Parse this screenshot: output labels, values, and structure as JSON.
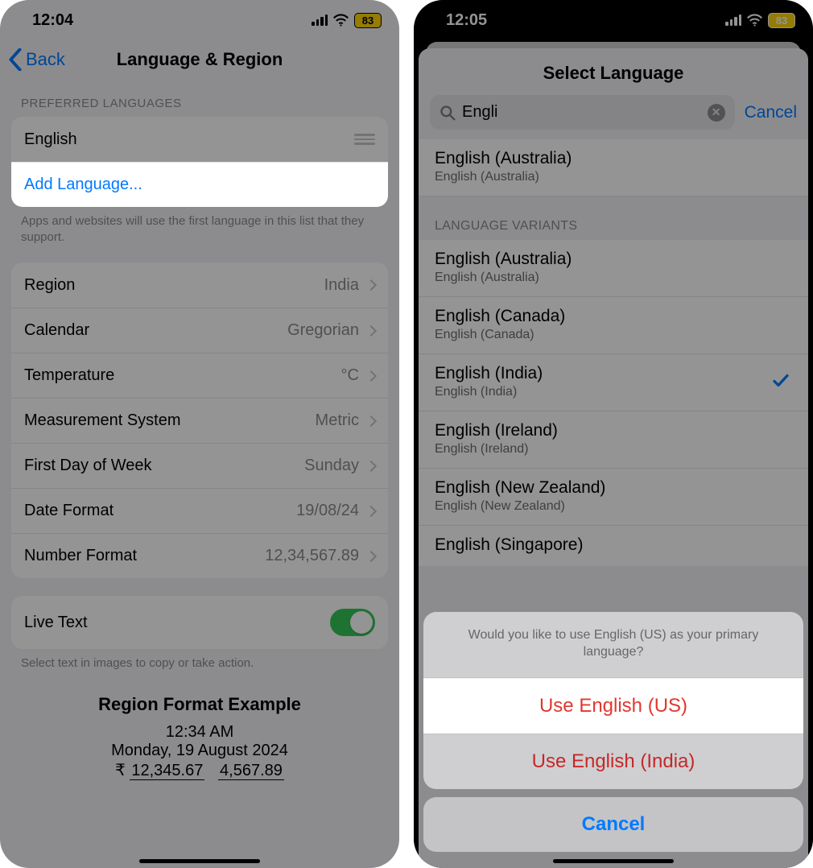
{
  "left": {
    "status": {
      "time": "12:04",
      "battery": "83"
    },
    "nav": {
      "back": "Back",
      "title": "Language & Region"
    },
    "preferred": {
      "header": "PREFERRED LANGUAGES",
      "current": "English",
      "add": "Add Language...",
      "footer": "Apps and websites will use the first language in this list that they support."
    },
    "settings": {
      "region": {
        "label": "Region",
        "value": "India"
      },
      "calendar": {
        "label": "Calendar",
        "value": "Gregorian"
      },
      "temperature": {
        "label": "Temperature",
        "value": "°C"
      },
      "measurement": {
        "label": "Measurement System",
        "value": "Metric"
      },
      "firstday": {
        "label": "First Day of Week",
        "value": "Sunday"
      },
      "dateformat": {
        "label": "Date Format",
        "value": "19/08/24"
      },
      "numberformat": {
        "label": "Number Format",
        "value": "12,34,567.89"
      }
    },
    "livetext": {
      "label": "Live Text",
      "on": true,
      "footer": "Select text in images to copy or take action."
    },
    "example": {
      "header": "Region Format Example",
      "time": "12:34 AM",
      "date": "Monday, 19 August 2024",
      "currency": "₹ 12,345.67",
      "number": "4,567.89"
    }
  },
  "right": {
    "status": {
      "time": "12:05",
      "battery": "83"
    },
    "sheet": {
      "title": "Select Language",
      "search": {
        "query": "Engli",
        "cancel": "Cancel"
      },
      "topitem": {
        "title": "English (Australia)",
        "sub": "English (Australia)"
      },
      "variants_header": "LANGUAGE VARIANTS",
      "variants": [
        {
          "title": "English (Australia)",
          "sub": "English (Australia)",
          "selected": false
        },
        {
          "title": "English (Canada)",
          "sub": "English (Canada)",
          "selected": false
        },
        {
          "title": "English (India)",
          "sub": "English (India)",
          "selected": true
        },
        {
          "title": "English (Ireland)",
          "sub": "English (Ireland)",
          "selected": false
        },
        {
          "title": "English (New Zealand)",
          "sub": "English (New Zealand)",
          "selected": false
        },
        {
          "title": "English (Singapore)",
          "sub": "",
          "selected": false
        }
      ]
    },
    "actionsheet": {
      "message": "Would you like to use English (US) as your primary language?",
      "primary": "Use English (US)",
      "secondary": "Use English (India)",
      "cancel": "Cancel"
    }
  }
}
